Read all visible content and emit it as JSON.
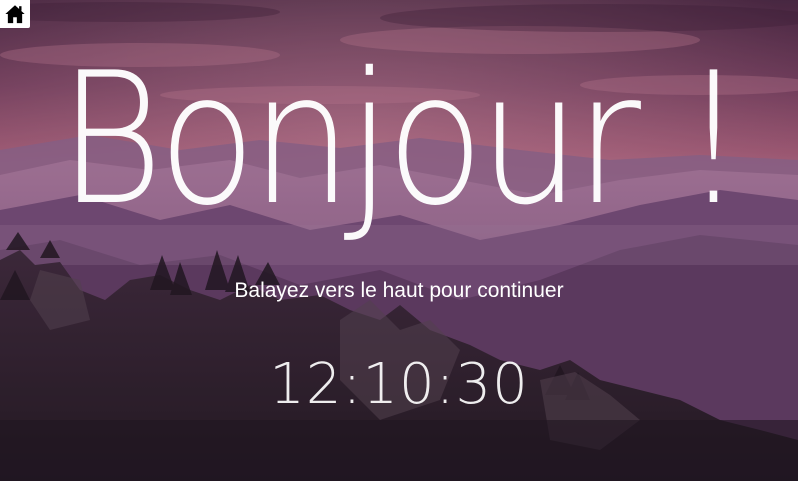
{
  "lockscreen": {
    "greeting": "Bonjour !",
    "hint": "Balayez vers le haut pour continuer",
    "time": "12:10:30"
  },
  "home_button": {
    "icon": "home-icon"
  },
  "colors": {
    "sky_top": "#5a3550",
    "sky_glow": "#c46a86",
    "mountain_far": "#8a5a86",
    "mountain_mid": "#6b3f66",
    "forest": "#2f2530",
    "text": "#ffffff"
  }
}
